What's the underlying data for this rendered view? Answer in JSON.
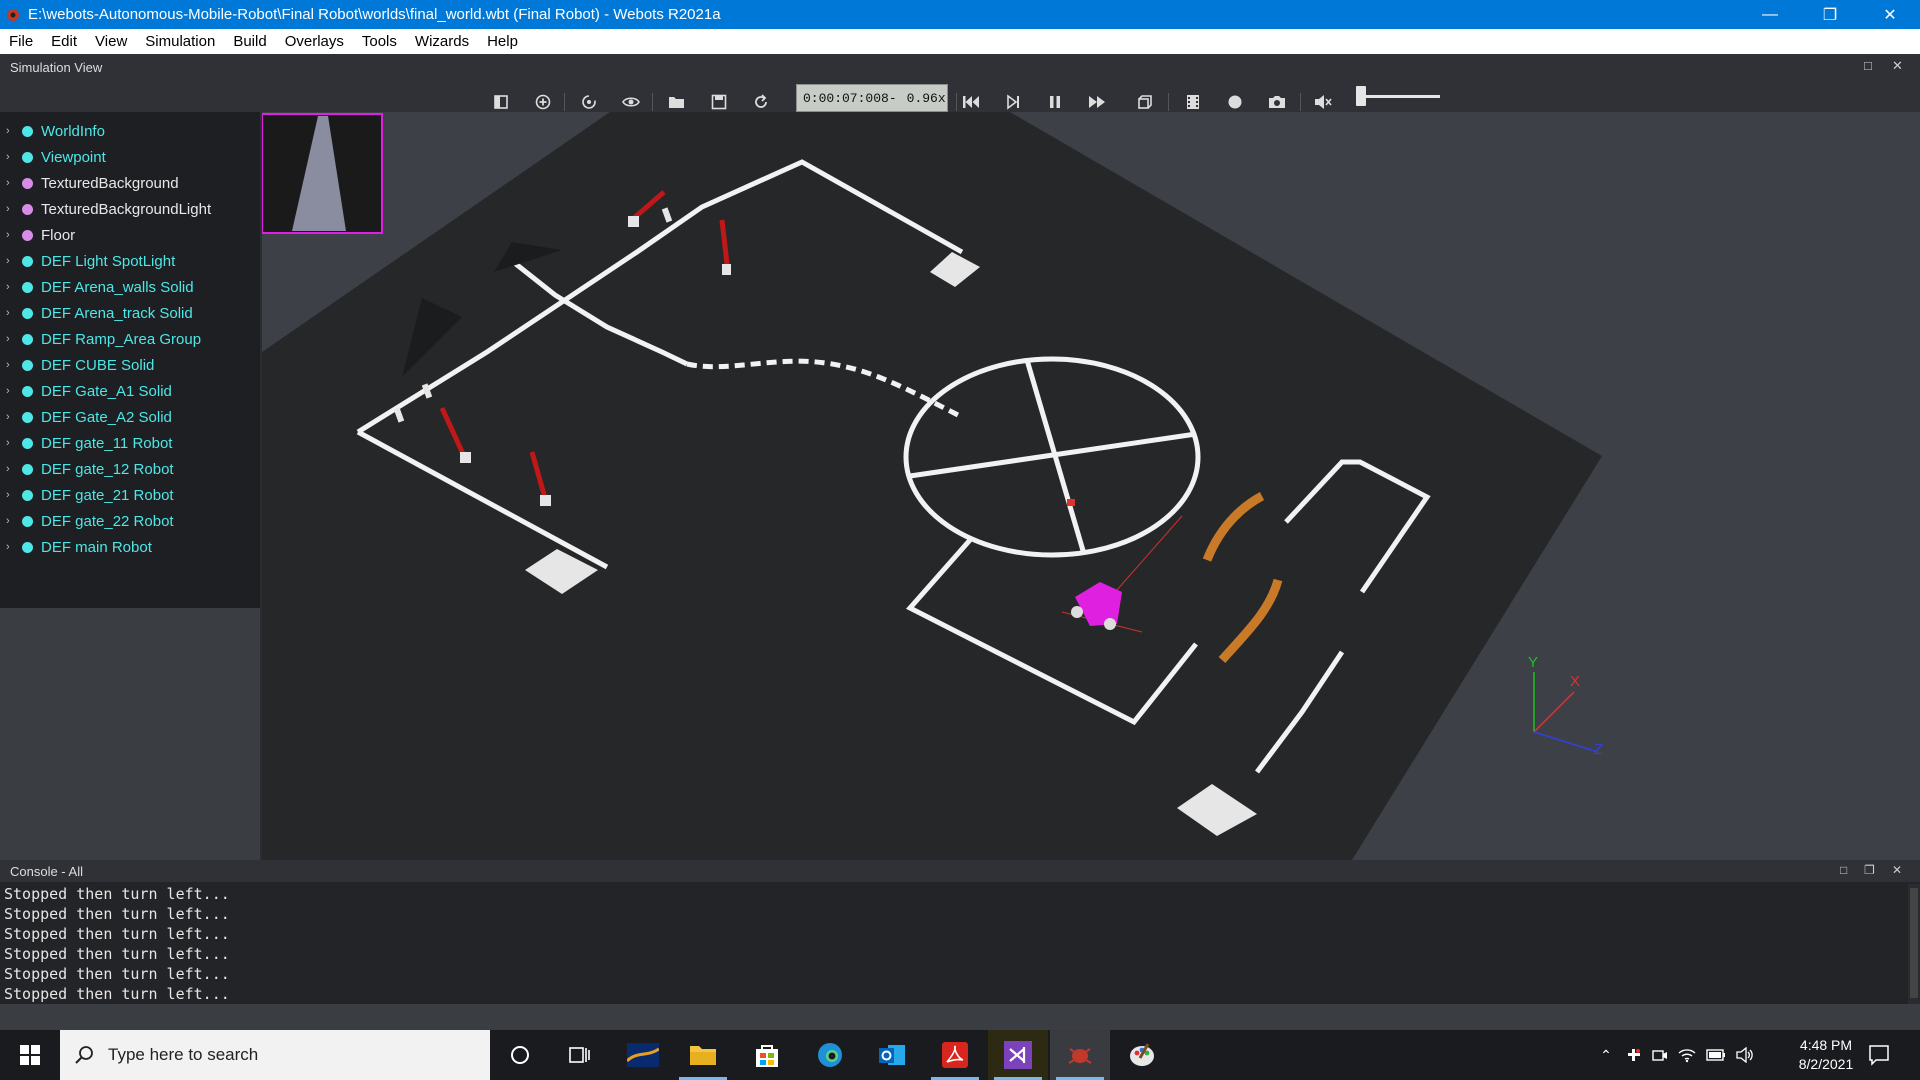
{
  "window": {
    "title": "E:\\webots-Autonomous-Mobile-Robot\\Final Robot\\worlds\\final_world.wbt (Final Robot) - Webots R2021a",
    "minimize_glyph": "—",
    "restore_glyph": "❐",
    "close_glyph": "✕"
  },
  "menu": [
    "File",
    "Edit",
    "View",
    "Simulation",
    "Build",
    "Overlays",
    "Tools",
    "Wizards",
    "Help"
  ],
  "simulation_view": {
    "title": "Simulation View",
    "time": "0:00:07:008",
    "speed_sep": "-",
    "speed": "0.96x",
    "volume": 0.05
  },
  "scene_tree": [
    {
      "name": "WorldInfo",
      "color": "#4ee6e6"
    },
    {
      "name": "Viewpoint",
      "color": "#4ee6e6"
    },
    {
      "name": "TexturedBackground",
      "color": "#d98be8"
    },
    {
      "name": "TexturedBackgroundLight",
      "color": "#d98be8"
    },
    {
      "name": "Floor",
      "color": "#d98be8"
    },
    {
      "name": "DEF Light SpotLight",
      "color": "#4ee6e6"
    },
    {
      "name": "DEF Arena_walls Solid",
      "color": "#4ee6e6"
    },
    {
      "name": "DEF Arena_track Solid",
      "color": "#4ee6e6"
    },
    {
      "name": "DEF Ramp_Area Group",
      "color": "#4ee6e6"
    },
    {
      "name": "DEF CUBE Solid",
      "color": "#4ee6e6"
    },
    {
      "name": "DEF Gate_A1 Solid",
      "color": "#4ee6e6"
    },
    {
      "name": "DEF Gate_A2 Solid",
      "color": "#4ee6e6"
    },
    {
      "name": "DEF gate_11 Robot",
      "color": "#4ee6e6"
    },
    {
      "name": "DEF gate_12 Robot",
      "color": "#4ee6e6"
    },
    {
      "name": "DEF gate_21 Robot",
      "color": "#4ee6e6"
    },
    {
      "name": "DEF gate_22 Robot",
      "color": "#4ee6e6"
    },
    {
      "name": "DEF main Robot",
      "color": "#4ee6e6"
    }
  ],
  "axes": {
    "x": "X",
    "y": "Y",
    "z": "Z"
  },
  "console": {
    "title": "Console - All",
    "lines": [
      "Stopped then turn left...",
      "Stopped then turn left...",
      "Stopped then turn left...",
      "Stopped then turn left...",
      "Stopped then turn left...",
      "Stopped then turn left..."
    ]
  },
  "taskbar": {
    "search_placeholder": "Type here to search",
    "time": "4:48 PM",
    "date": "8/2/2021"
  }
}
